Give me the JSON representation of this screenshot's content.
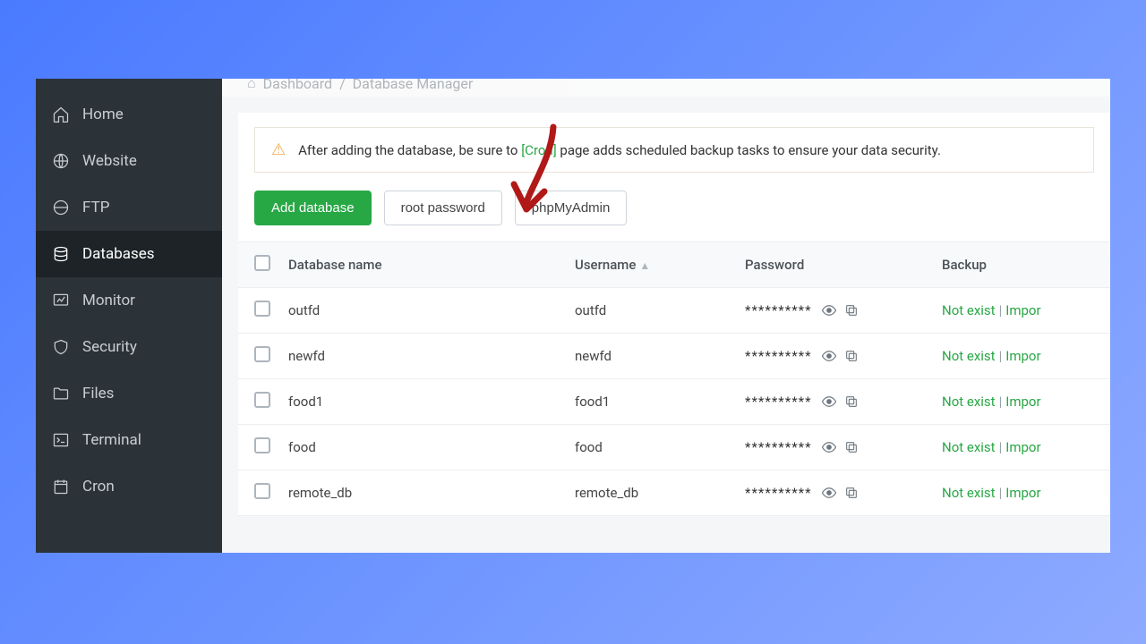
{
  "breadcrumb": {
    "home_icon": "⌂",
    "dashboard": "Dashboard",
    "current": "Database Manager"
  },
  "sidebar": {
    "items": [
      {
        "label": "Home",
        "icon": "home"
      },
      {
        "label": "Website",
        "icon": "globe"
      },
      {
        "label": "FTP",
        "icon": "ftp"
      },
      {
        "label": "Databases",
        "icon": "database",
        "active": true
      },
      {
        "label": "Monitor",
        "icon": "monitor"
      },
      {
        "label": "Security",
        "icon": "shield"
      },
      {
        "label": "Files",
        "icon": "folder"
      },
      {
        "label": "Terminal",
        "icon": "terminal"
      },
      {
        "label": "Cron",
        "icon": "calendar"
      }
    ]
  },
  "alert": {
    "prefix": "After adding the database, be sure to ",
    "link": "[Cron]",
    "suffix": " page adds scheduled backup tasks to ensure your data security."
  },
  "toolbar": {
    "add_label": "Add database",
    "root_pw_label": "root password",
    "phpmyadmin_label": "phpMyAdmin"
  },
  "table": {
    "headers": {
      "name": "Database name",
      "user": "Username",
      "pass": "Password",
      "backup": "Backup"
    },
    "password_mask": "**********",
    "backup_text": {
      "not_exist": "Not exist",
      "import": "Impor"
    },
    "rows": [
      {
        "name": "outfd",
        "user": "outfd"
      },
      {
        "name": "newfd",
        "user": "newfd"
      },
      {
        "name": "food1",
        "user": "food1"
      },
      {
        "name": "food",
        "user": "food"
      },
      {
        "name": "remote_db",
        "user": "remote_db"
      }
    ]
  }
}
